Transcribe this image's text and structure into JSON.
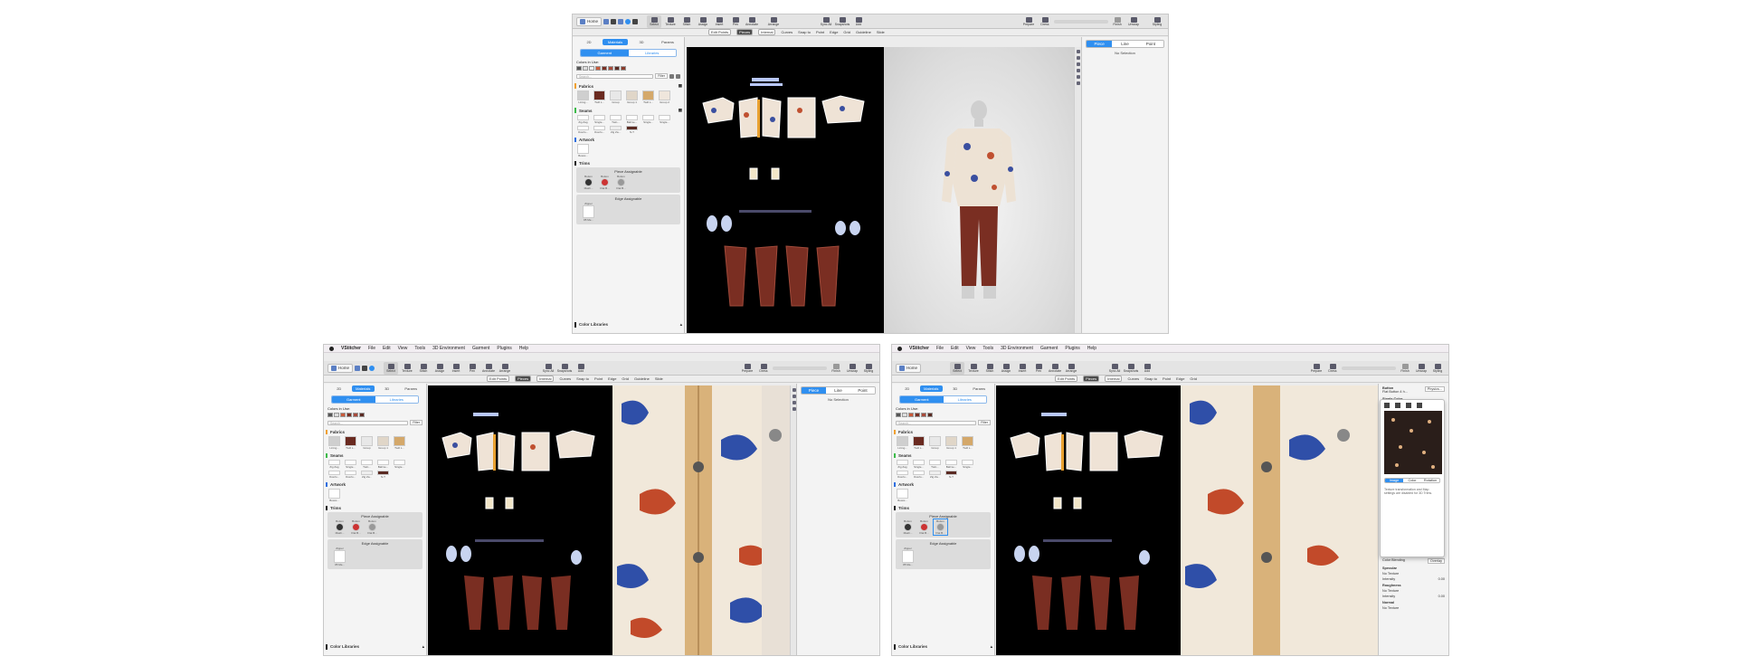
{
  "menubar": {
    "app_name": "VStitcher",
    "items": [
      "File",
      "Edit",
      "View",
      "Tools",
      "3D Environment",
      "Garment",
      "Plugins",
      "Help"
    ]
  },
  "toolbar": {
    "home_label": "Home",
    "tools": [
      "Select",
      "Texture",
      "Stitch",
      "Assign",
      "Insert",
      "Pen",
      "Annotate",
      "Arrange"
    ],
    "mid_tools": [
      "Sync All",
      "Snapshots",
      "Add"
    ],
    "right_tools": [
      "Prepare",
      "Dress",
      "Finish",
      "Unwrap",
      "Styling"
    ]
  },
  "subbar": {
    "items": [
      "Edit Points",
      "Pieces",
      "Internal",
      "Curves",
      "Snap to",
      "Point",
      "Edge",
      "Grid",
      "Guideline",
      "Slide"
    ],
    "zoom": "Arms Down"
  },
  "left_panel": {
    "tabs": [
      "2D",
      "Materials",
      "3D",
      "Params"
    ],
    "active_tab": "Materials",
    "segment": [
      "Garment",
      "Libraries"
    ],
    "colors_in_use": "Colors in Use:",
    "search_placeholder": "Search...",
    "filter_label": "Filter",
    "sections": {
      "fabrics": "Fabrics",
      "seams": "Seams",
      "artwork": "Artwork",
      "trims": "Trims",
      "color_libraries": "Color Libraries"
    },
    "fabric_items": [
      "Lining...",
      "Twill L...",
      "Group",
      "Group 1",
      "Twill L...",
      "Group 2"
    ],
    "seam_items_1": [
      "Zig Zag",
      "Single...",
      "Twin...",
      "Ball ke...",
      "Single...",
      "Single..."
    ],
    "seam_items_2": [
      "Overlo...",
      "Overlo...",
      "Zig Za...",
      "N-T"
    ],
    "artwork_items": [
      "Bowsi..."
    ],
    "piece_assignable": "Piece Assignable",
    "trim_items": [
      "Button",
      "Button",
      "Button"
    ],
    "trim_labels": [
      "Mash...",
      "Flat B...",
      "Flat B..."
    ],
    "edge_assignable": "Edge Assignable",
    "zipper": "Zipper",
    "zipper_label": "#5 Me..."
  },
  "right_panel": {
    "tabs": [
      "Piece",
      "Line",
      "Point"
    ],
    "no_selection": "No Selection",
    "zoom_readout": "77% - 91.167"
  },
  "inspector": {
    "object": "Button",
    "object_name": "Flat Button 4 h...",
    "mode": "Physics...",
    "color_mode": "Single Color",
    "tabs": [
      "Image",
      "Color",
      "Rotation"
    ],
    "note": "Texture transformation and Map settings are disabled for 3D Trims.",
    "color_blending": "Color Blending",
    "blending_value": "Overlay",
    "specular": "Specular",
    "roughness": "Roughness",
    "normal": "Normal",
    "no_texture": "No Texture",
    "intensity": "Intensity",
    "intensity_value": "0.00",
    "swatch_hex": "14B1B1B1"
  },
  "colors": {
    "accent": "#2f8ff0",
    "pants": "#7a2e22",
    "blue_label": "#3f6fff"
  }
}
